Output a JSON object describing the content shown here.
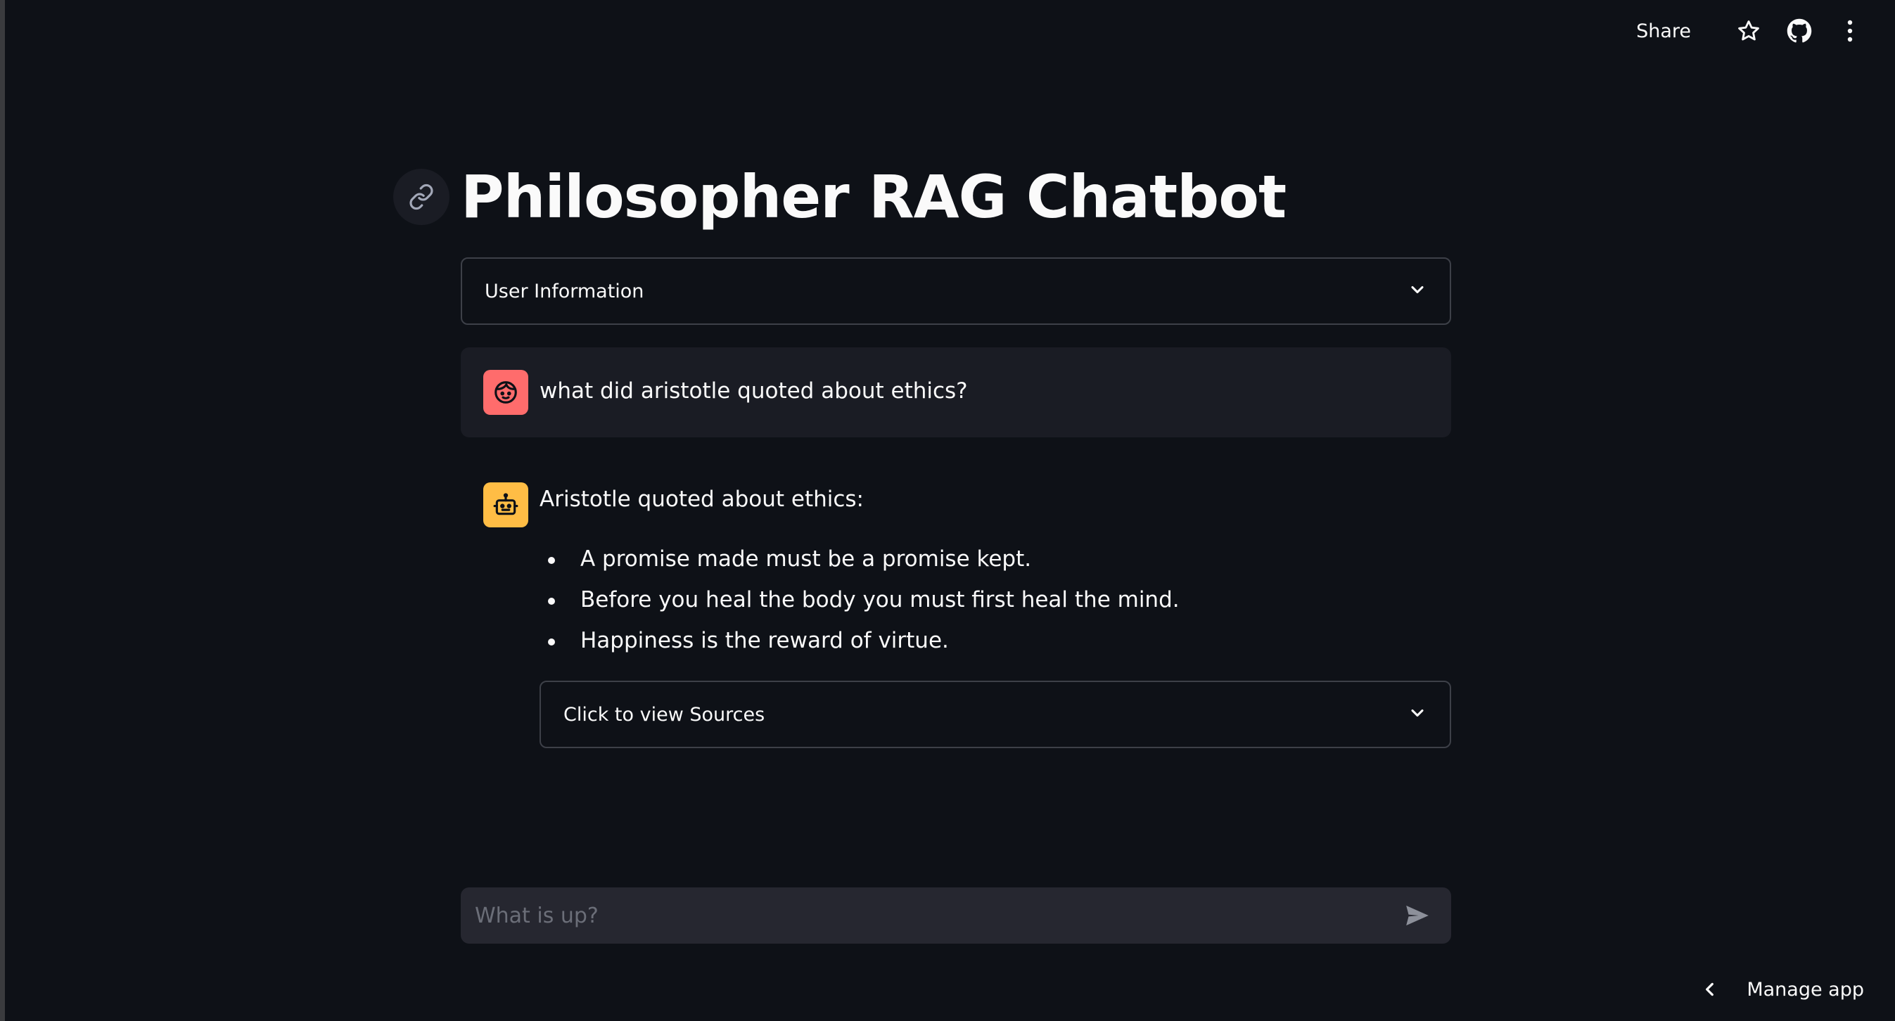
{
  "toolbar": {
    "share_label": "Share",
    "icons": [
      "star-icon",
      "github-icon",
      "more-vertical-icon"
    ]
  },
  "page": {
    "title": "Philosopher RAG Chatbot",
    "anchor_icon": "link-icon"
  },
  "user_info_expander": {
    "label": "User Information",
    "icon": "chevron-down-icon"
  },
  "messages": [
    {
      "role": "user",
      "avatar_icon": "user-face-icon",
      "avatar_color": "#ff6c6c",
      "text": "what did aristotle quoted about ethics?"
    },
    {
      "role": "assistant",
      "avatar_icon": "robot-icon",
      "avatar_color": "#ffbd45",
      "intro": "Aristotle quoted about ethics:",
      "bullets": [
        "A promise made must be a promise kept.",
        "Before you heal the body you must first heal the mind.",
        "Happiness is the reward of virtue."
      ],
      "sources_label": "Click to view Sources"
    }
  ],
  "chat_input": {
    "placeholder": "What is up?",
    "value": "",
    "send_icon": "send-icon"
  },
  "footer": {
    "manage_label": "Manage app",
    "manage_icon": "chevron-left-icon"
  },
  "colors": {
    "background": "#0e1117",
    "surface": "#1a1c24",
    "input": "#262730",
    "border": "#3d4048",
    "text": "#fafafa",
    "user_avatar": "#ff6c6c",
    "assistant_avatar": "#ffbd45"
  }
}
